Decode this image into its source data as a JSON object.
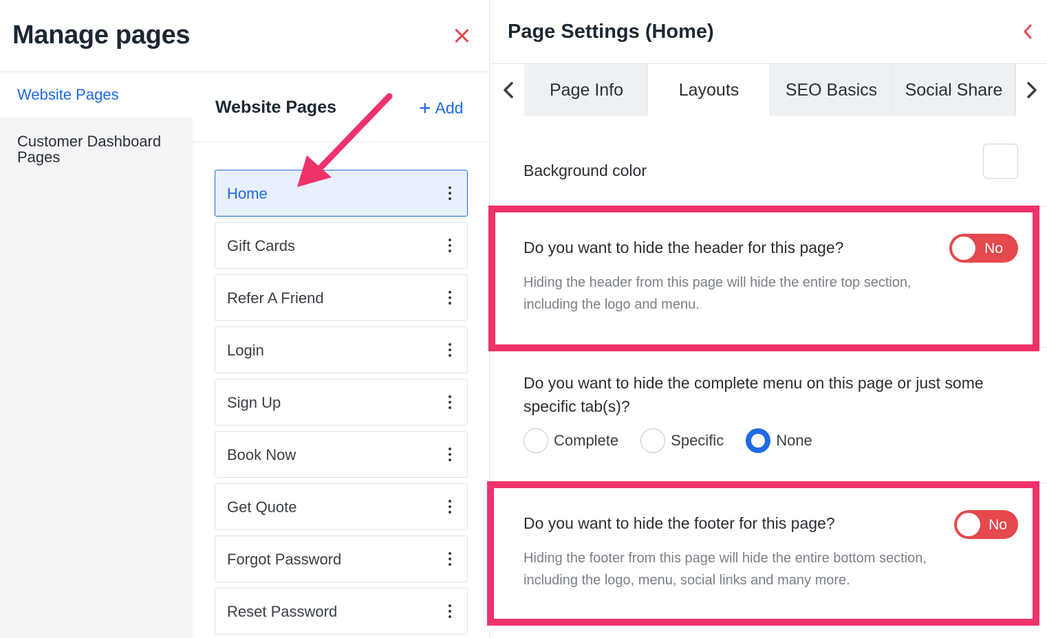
{
  "left_panel": {
    "title": "Manage pages",
    "nav": {
      "items": [
        {
          "label": "Website Pages",
          "active": true
        },
        {
          "label": "Customer Dashboard Pages",
          "active": false
        }
      ]
    },
    "pages": {
      "title": "Website Pages",
      "add_label": "Add",
      "items": [
        {
          "label": "Home",
          "selected": true
        },
        {
          "label": "Gift Cards",
          "selected": false
        },
        {
          "label": "Refer A Friend",
          "selected": false
        },
        {
          "label": "Login",
          "selected": false
        },
        {
          "label": "Sign Up",
          "selected": false
        },
        {
          "label": "Book Now",
          "selected": false
        },
        {
          "label": "Get Quote",
          "selected": false
        },
        {
          "label": "Forgot Password",
          "selected": false
        },
        {
          "label": "Reset Password",
          "selected": false
        }
      ]
    }
  },
  "right_panel": {
    "title": "Page Settings (Home)",
    "tabs": [
      {
        "label": "Page Info",
        "active": false
      },
      {
        "label": "Layouts",
        "active": true
      },
      {
        "label": "SEO Basics",
        "active": false
      },
      {
        "label": "Social Share",
        "active": false
      }
    ],
    "background_color_label": "Background color",
    "header_setting": {
      "question": "Do you want to hide the header for this page?",
      "toggle_value": "No",
      "description": "Hiding the header from this page will hide the entire top section, including the logo and menu."
    },
    "menu_setting": {
      "question": "Do you want to hide the complete menu on this page or just some specific tab(s)?",
      "options": [
        {
          "label": "Complete",
          "checked": false
        },
        {
          "label": "Specific",
          "checked": false
        },
        {
          "label": "None",
          "checked": true
        }
      ]
    },
    "footer_setting": {
      "question": "Do you want to hide the footer for this page?",
      "toggle_value": "No",
      "description": "Hiding the footer from this page will hide the entire bottom section, including the logo, menu, social links and many more."
    }
  },
  "colors": {
    "accent": "#1e6be6",
    "danger": "#e5484d",
    "highlight": "#f0326a"
  },
  "icons": [
    "close-icon",
    "plus-icon",
    "kebab-menu-icon",
    "chevron-left-icon",
    "chevron-right-icon"
  ]
}
